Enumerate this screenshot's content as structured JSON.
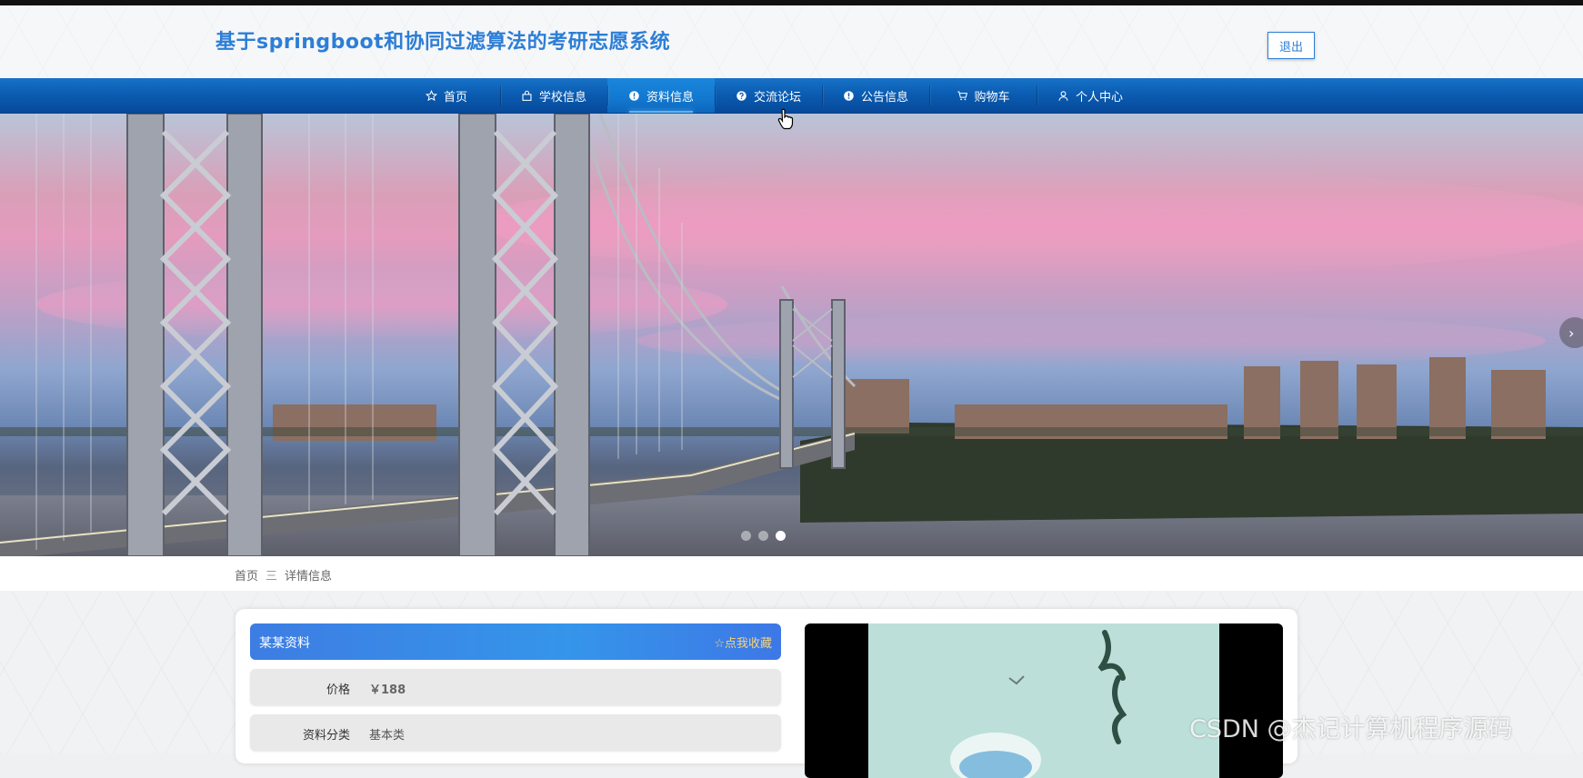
{
  "header": {
    "title": "基于springboot和协同过滤算法的考研志愿系统",
    "logout_label": "退出"
  },
  "nav": {
    "items": [
      {
        "label": "首页",
        "icon": "star-icon"
      },
      {
        "label": "学校信息",
        "icon": "bag-icon"
      },
      {
        "label": "资料信息",
        "icon": "info-circle-icon",
        "active": true
      },
      {
        "label": "交流论坛",
        "icon": "question-circle-icon"
      },
      {
        "label": "公告信息",
        "icon": "info-circle-icon"
      },
      {
        "label": "购物车",
        "icon": "cart-icon"
      },
      {
        "label": "个人中心",
        "icon": "user-icon"
      }
    ]
  },
  "carousel": {
    "next_glyph": "›",
    "dots": 3,
    "active_dot": 3
  },
  "breadcrumb": {
    "home": "首页",
    "separator": "三",
    "current": "详情信息"
  },
  "detail": {
    "title": "某某资料",
    "favorite_label": "☆点我收藏",
    "fields": [
      {
        "label": "价格",
        "value": "￥188"
      },
      {
        "label": "资料分类",
        "value": "基本类"
      }
    ]
  },
  "watermark": "CSDN @杰记计算机程序源码",
  "colors": {
    "title_blue": "#2d7ed6",
    "nav_blue": "#0a5bb0",
    "favorite_gold": "#f6d47a"
  }
}
